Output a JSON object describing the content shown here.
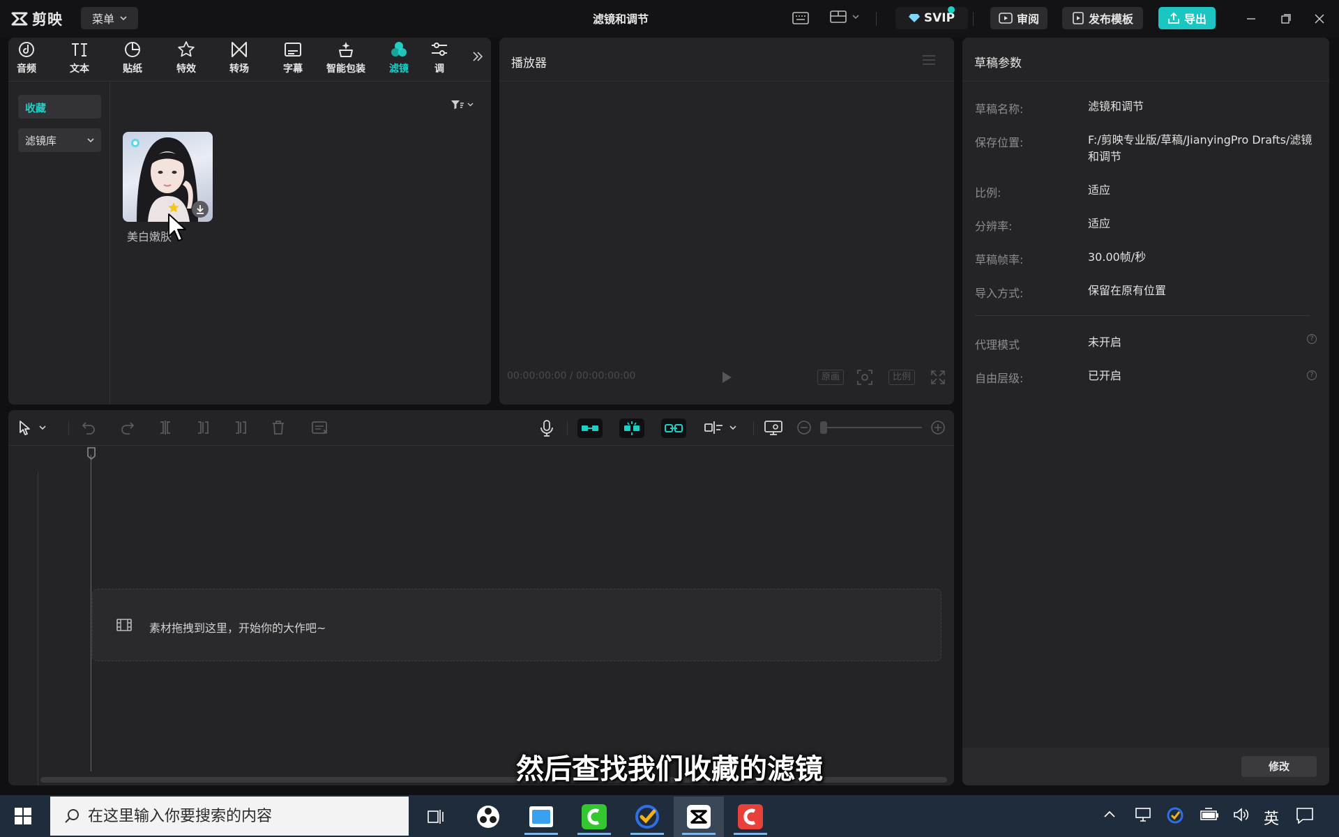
{
  "app": {
    "logo_text": "剪映",
    "menu_label": "菜单",
    "document_title": "滤镜和调节",
    "svip_label": "SVIP",
    "review_label": "审阅",
    "publish_label": "发布模板",
    "export_label": "导出"
  },
  "toolbar": {
    "tabs": [
      {
        "label": "音频",
        "icon": "audio-icon"
      },
      {
        "label": "文本",
        "icon": "text-icon"
      },
      {
        "label": "贴纸",
        "icon": "sticker-icon"
      },
      {
        "label": "特效",
        "icon": "effects-star-icon"
      },
      {
        "label": "转场",
        "icon": "transition-icon"
      },
      {
        "label": "字幕",
        "icon": "caption-icon"
      },
      {
        "label": "智能包装",
        "icon": "smart-pack-icon"
      },
      {
        "label": "滤镜",
        "icon": "filter-icon",
        "active": true
      },
      {
        "label": "调",
        "icon": "adjust-icon"
      }
    ]
  },
  "media": {
    "sidebar": {
      "favorites": "收藏",
      "library": "滤镜库"
    },
    "filters": [
      {
        "name": "美白嫩肤"
      }
    ]
  },
  "player": {
    "title": "播放器",
    "time_code": "00:00:00:00 / 00:00:00:00",
    "original_label": "原画",
    "ratio_label": "比例"
  },
  "draft": {
    "title": "草稿参数",
    "params": [
      {
        "label": "草稿名称:",
        "value": "滤镜和调节"
      },
      {
        "label": "保存位置:",
        "value": "F:/剪映专业版/草稿/JianyingPro Drafts/滤镜和调节"
      },
      {
        "label": "比例:",
        "value": "适应"
      },
      {
        "label": "分辨率:",
        "value": "适应"
      },
      {
        "label": "草稿帧率:",
        "value": "30.00帧/秒"
      },
      {
        "label": "导入方式:",
        "value": "保留在原有位置"
      },
      {
        "label": "代理模式",
        "value": "未开启"
      },
      {
        "label": "自由层级:",
        "value": "已开启"
      }
    ],
    "modify_label": "修改"
  },
  "timeline": {
    "drop_hint": "素材拖拽到这里，开始你的大作吧~"
  },
  "subtitle": "然后查找我们收藏的滤镜",
  "taskbar": {
    "search_placeholder": "在这里输入你要搜索的内容",
    "ime_label": "英"
  },
  "colors": {
    "accent": "#1ecfc5",
    "export_button": "#1bc6c2",
    "panel": "#242427",
    "background": "#101012"
  }
}
